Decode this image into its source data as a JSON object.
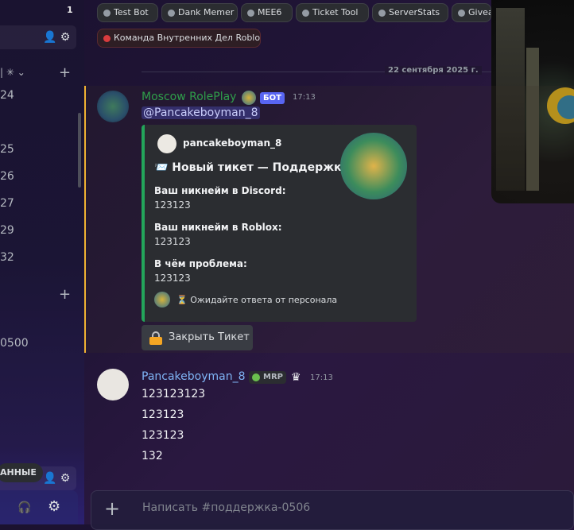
{
  "sidebar": {
    "count": "1",
    "category_label": "| ✳ ⌄",
    "channel_numbers": [
      "24",
      "25",
      "26",
      "27",
      "29",
      "32"
    ],
    "channel_partial": "0500",
    "tooltip": "АННЫЕ"
  },
  "tags": [
    {
      "label": "Test Bot",
      "color": "#949ba4"
    },
    {
      "label": "Dank Memer",
      "color": "#949ba4"
    },
    {
      "label": "MEE6",
      "color": "#949ba4"
    },
    {
      "label": "Ticket Tool",
      "color": "#949ba4"
    },
    {
      "label": "ServerStats",
      "color": "#949ba4"
    },
    {
      "label": "Givea",
      "color": "#949ba4"
    },
    {
      "label": "Команда Внутренних Дел Roblox",
      "color": "#d83c3e"
    }
  ],
  "date_divider": "22 сентября 2025 г.",
  "bot_message": {
    "author": "Moscow RolePlay",
    "bot_tag": "БОТ",
    "time": "17:13",
    "mention": "@Pancakeboyman_8",
    "embed": {
      "author": "pancakeboyman_8",
      "title": "📨 Новый тикет — Поддержка",
      "fields": [
        {
          "name": "Ваш никнейм в Discord:",
          "value": "123123"
        },
        {
          "name": "Ваш никнейм в Roblox:",
          "value": "123123"
        },
        {
          "name": "В чём проблема:",
          "value": "123123"
        }
      ],
      "footer": "⏳ Ожидайте ответа от персонала",
      "accent": "#23a55a"
    },
    "button_label": "Закрыть Тикет"
  },
  "user_message": {
    "author": "Pancakeboyman_8",
    "badge": "MRP",
    "time": "17:13",
    "lines": [
      "123123123",
      "123123",
      "123123",
      "132"
    ]
  },
  "composer": {
    "placeholder": "Написать #поддержка-0506"
  }
}
